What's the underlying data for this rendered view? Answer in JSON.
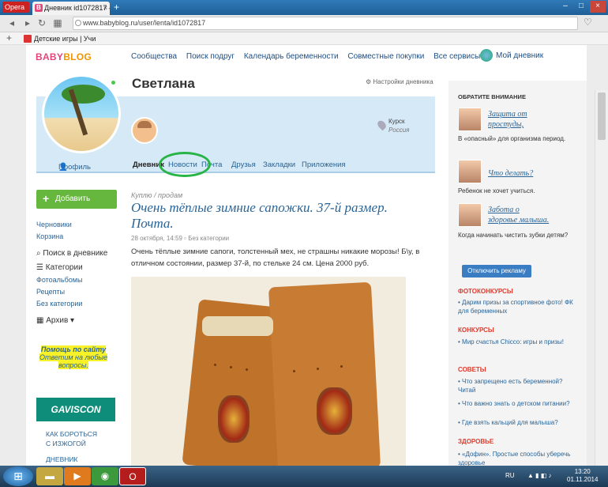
{
  "browser": {
    "opera_label": "Opera",
    "tab_title": "Дневник id1072817 – Bab",
    "tab_close": "×",
    "newtab": "+",
    "url": "www.babyblog.ru/user/lenta/id1072817",
    "bookmark": "Детские игры | Учи",
    "win_min": "–",
    "win_max": "□",
    "win_close": "×"
  },
  "site": {
    "logo1": "BABY",
    "logo2": "BLOG",
    "nav": [
      "Сообщества",
      "Поиск подруг",
      "Календарь беременности",
      "Совместные покупки",
      "Все сервисы"
    ],
    "my_diary": "Мой дневник"
  },
  "profile": {
    "name": "Светлана",
    "settings": "Настройки дневника",
    "city": "Курск",
    "country": "Россия",
    "tabs": [
      "Профиль",
      "Дневник",
      "Новости",
      "Почта",
      "Друзья",
      "Закладки",
      "Приложения"
    ]
  },
  "left": {
    "add_post": "Добавить запись",
    "drafts": "Черновики",
    "trash": "Корзина",
    "search": "Поиск в дневнике",
    "categories": "Категории",
    "cat_items": [
      "Фотоальбомы",
      "Рецепты",
      "Без категории"
    ],
    "archive": "Архив",
    "help_title": "Помощь по сайту",
    "help_sub1": "Ответим на любые",
    "help_sub2": "вопросы.",
    "ad_brand": "GAVISCON",
    "ad_links": [
      "КАК БОРОТЬСЯ",
      "С ИЗЖОГОЙ",
      "ДНЕВНИК"
    ]
  },
  "post": {
    "category": "Куплю / продам",
    "title": "Очень тёплые зимние сапожки. 37-й размер. Почта.",
    "date": "28 октября, 14:59",
    "uncat": "Без категории",
    "text": "Очень тёплые зимние сапоги, толстенный мех, не страшны никакие морозы! Б\\у, в отличном состоянии, размер 37-й, по стельке 24 см. Цена 2000 руб."
  },
  "right": {
    "attention": "ОБРАТИТЕ ВНИМАНИЕ",
    "items": [
      {
        "link1": "Защита от",
        "link2": "простуды,",
        "desc": "В «опасный» для организма период."
      },
      {
        "link1": "Что делать?",
        "link2": "",
        "desc": "Ребенок не хочет учиться."
      },
      {
        "link1": "Забота о",
        "link2": "здоровье малыша.",
        "desc": "Когда начинать чистить зубки детям?"
      }
    ],
    "off_ads": "Отключить рекламу",
    "photo_contests": "ФОТОКОНКУРСЫ",
    "photo_link": "• Дарим призы за спортивное фото! ФК для беременных",
    "contests": "КОНКУРСЫ",
    "contest_link": "• Мир счастья Chicco: игры и призы!",
    "tips": "СОВЕТЫ",
    "tip_links": [
      "• Что запрещено есть беременной? Читай",
      "• Что важно знать о детском питании?",
      "• Где взять кальций для малыша?"
    ],
    "health": "ЗДОРОВЬЕ",
    "health_link": "• «Дофин». Простые способы уберечь здоровье"
  },
  "taskbar": {
    "lang": "RU",
    "time": "13:20",
    "date": "01.11.2014"
  }
}
